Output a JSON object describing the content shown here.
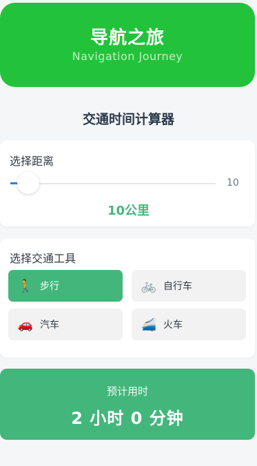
{
  "header": {
    "title": "导航之旅",
    "subtitle": "Navigation Journey"
  },
  "calculator": {
    "title": "交通时间计算器"
  },
  "distance": {
    "label": "选择距离",
    "slider_value": "10",
    "slider_fraction": 0.0,
    "display": "10公里"
  },
  "transport": {
    "label": "选择交通工具",
    "modes": [
      {
        "icon": "🚶",
        "icon_name": "walking-person-icon",
        "label": "步行",
        "active": true
      },
      {
        "icon": "🚲",
        "icon_name": "bicycle-icon",
        "label": "自行车",
        "active": false
      },
      {
        "icon": "🚗",
        "icon_name": "car-icon",
        "label": "汽车",
        "active": false
      },
      {
        "icon": "🚄",
        "icon_name": "train-icon",
        "label": "火车",
        "active": false
      }
    ]
  },
  "result": {
    "label": "预计用时",
    "value": "2 小时 0 分钟"
  },
  "colors": {
    "header_bg": "#22c33a",
    "accent": "#43b77b",
    "slider_fill": "#2f7fe6"
  }
}
